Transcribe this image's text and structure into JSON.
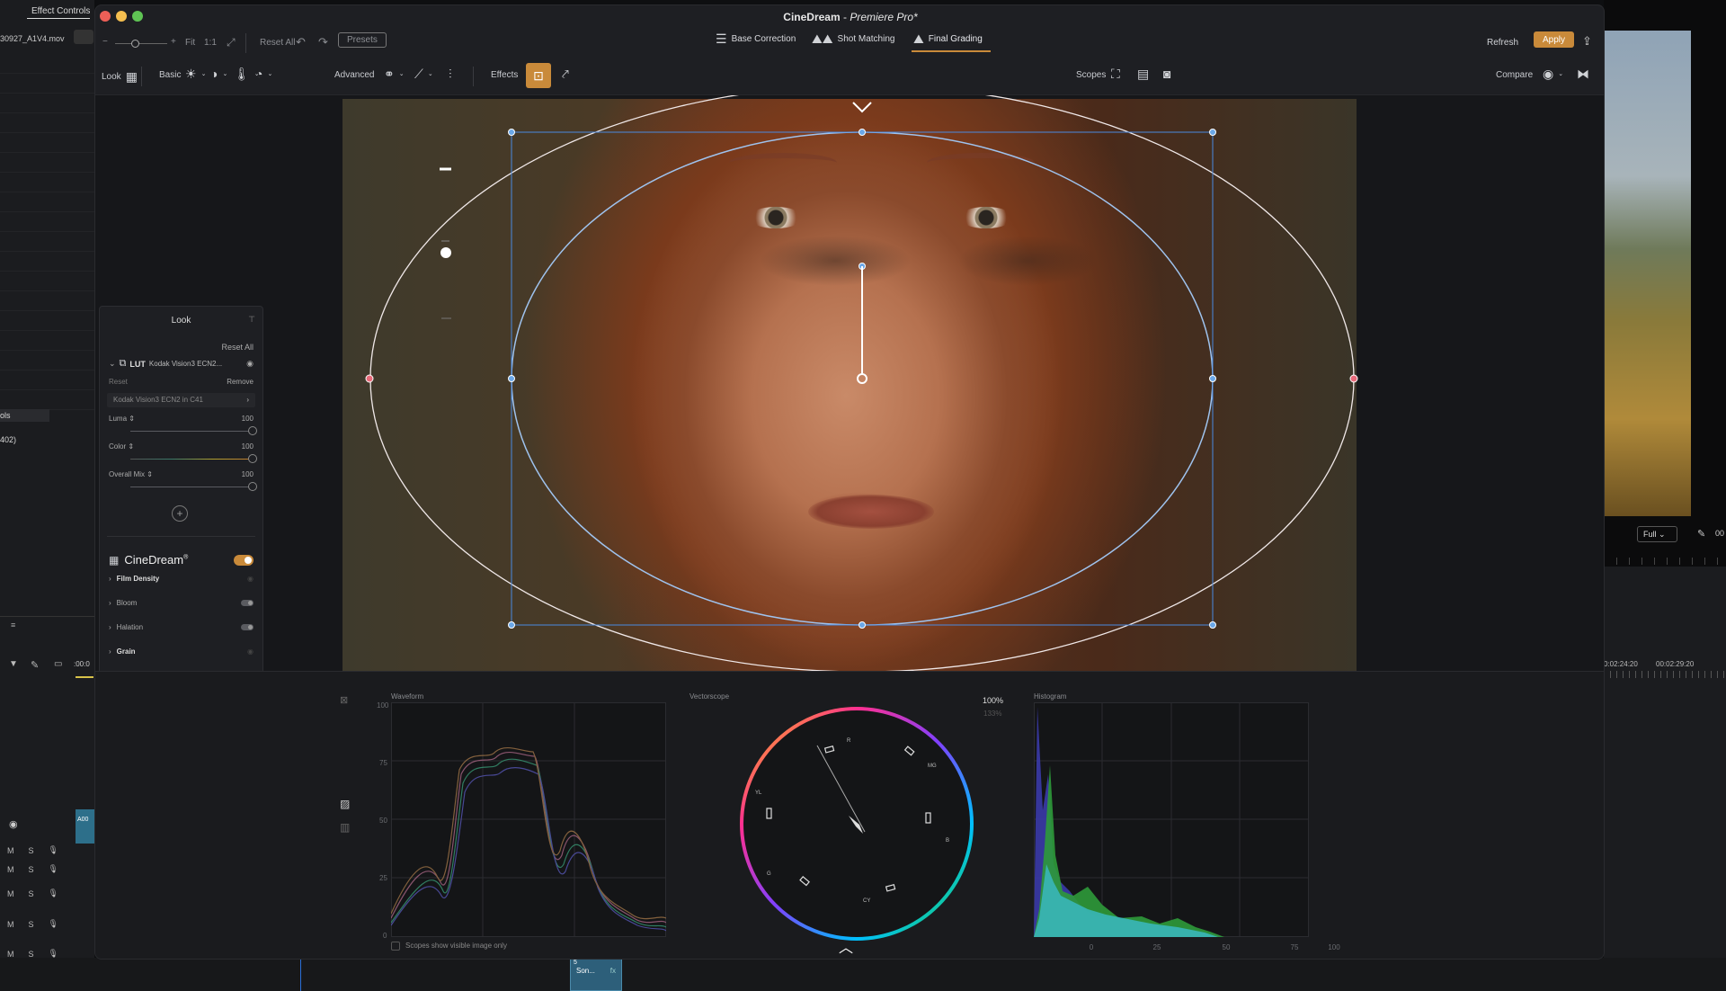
{
  "premiere": {
    "tab_effect_controls": "Effect Controls",
    "clip_name": "30927_A1V4.mov",
    "left_label_ols": "ols",
    "left_label_402": "402)",
    "timecode_start": ":00:0",
    "clip_chip": "A00",
    "track_m": "M",
    "track_s": "S",
    "bottom_clip_num": "5",
    "bottom_clip_label": "Son...",
    "bottom_clip_fx": "fx",
    "right_full": "Full",
    "right_timecode1": "0:02:24:20",
    "right_timecode2": "00:02:29:20",
    "right_frag": "00"
  },
  "window": {
    "title_app": "CineDream",
    "title_sep": " - ",
    "title_host": "Premiere Pro*"
  },
  "toolbar1": {
    "fit": "Fit",
    "one_to_one": "1:1",
    "reset_all": "Reset All",
    "presets": "Presets",
    "workflow_tabs": [
      "Base Correction",
      "Shot Matching",
      "Final Grading"
    ],
    "active_tab": "Final Grading",
    "refresh": "Refresh",
    "apply": "Apply"
  },
  "toolbar2": {
    "look": "Look",
    "basic": "Basic",
    "advanced": "Advanced",
    "effects": "Effects",
    "scopes": "Scopes",
    "compare": "Compare"
  },
  "look_panel": {
    "title": "Look",
    "reset_all": "Reset All",
    "lut_label": "LUT",
    "lut_name": "Kodak Vision3 ECN2...",
    "reset": "Reset",
    "remove": "Remove",
    "lut_select": "Kodak Vision3 ECN2 in C41",
    "sliders": [
      {
        "label": "Luma",
        "value": "100"
      },
      {
        "label": "Color",
        "value": "100"
      },
      {
        "label": "Overall Mix",
        "value": "100"
      }
    ],
    "brand": "CineDream",
    "brand_mark": "®",
    "effects": [
      {
        "label": "Film Density",
        "bold": true
      },
      {
        "label": "Bloom",
        "bold": false
      },
      {
        "label": "Halation",
        "bold": false
      },
      {
        "label": "Grain",
        "bold": true
      }
    ]
  },
  "scopes": {
    "waveform_title": "Waveform",
    "waveform_ticks": [
      "100",
      "75",
      "50",
      "25",
      "0"
    ],
    "checkbox_label": "Scopes show visible image only",
    "vectorscope_title": "Vectorscope",
    "zoom_100": "100%",
    "zoom_133": "133%",
    "vector_labels": [
      "R",
      "MG",
      "B",
      "CY",
      "G",
      "YL"
    ],
    "histogram_title": "Histogram",
    "histogram_ticks": [
      "0",
      "25",
      "50",
      "75",
      "100"
    ]
  },
  "colors": {
    "accent": "#c98a3a",
    "overlay_blue": "#6aa7e8",
    "overlay_red": "#e86a7a"
  }
}
